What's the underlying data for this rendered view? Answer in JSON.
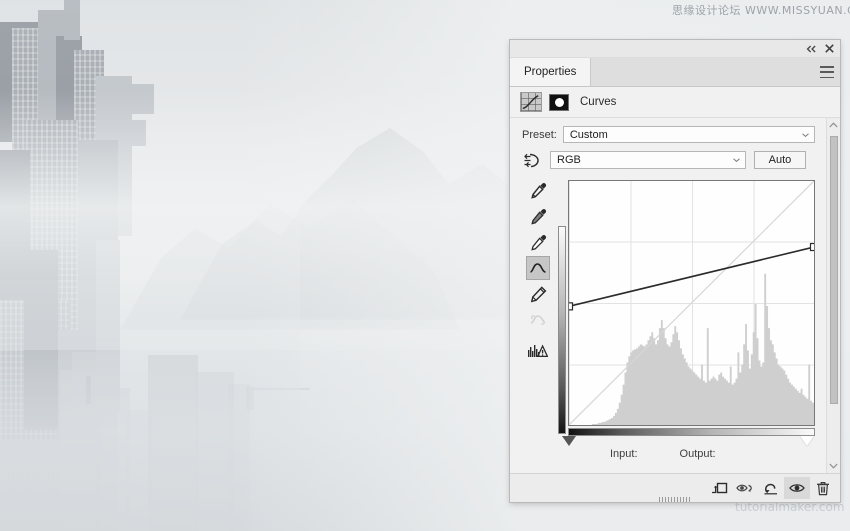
{
  "watermarks": {
    "top": "思缘设计论坛 WWW.MISSYUAN.COM",
    "bottom": "tutorialmaker.com"
  },
  "panel": {
    "titlebar": {
      "collapse_icon": "double-chevron-left-icon",
      "close_icon": "close-icon"
    },
    "tab": "Properties",
    "menu_icon": "panel-menu-icon",
    "adjustment": {
      "icon": "curves-adjustment-icon",
      "mask_icon": "layer-mask-thumbnail",
      "title": "Curves"
    },
    "preset": {
      "label": "Preset:",
      "value": "Custom",
      "chevron_icon": "chevron-down-icon"
    },
    "channel": {
      "target_adjust_icon": "on-image-adjustment-icon",
      "value": "RGB",
      "chevron_icon": "chevron-down-icon",
      "auto_label": "Auto"
    },
    "tools": [
      {
        "name": "sample-in-image-to-set-black-point",
        "icon": "eyedropper-black-icon",
        "selected": false,
        "disabled": false
      },
      {
        "name": "sample-in-image-to-set-gray-point",
        "icon": "eyedropper-gray-icon",
        "selected": false,
        "disabled": false
      },
      {
        "name": "sample-in-image-to-set-white-point",
        "icon": "eyedropper-white-icon",
        "selected": false,
        "disabled": false
      },
      {
        "name": "edit-points-to-modify-curve",
        "icon": "curve-point-tool-icon",
        "selected": true,
        "disabled": false
      },
      {
        "name": "draw-to-modify-curve",
        "icon": "pencil-icon",
        "selected": false,
        "disabled": false
      },
      {
        "name": "smooth-curve-values",
        "icon": "smooth-curve-icon",
        "selected": false,
        "disabled": true
      },
      {
        "name": "curves-display-options",
        "icon": "histogram-warning-icon",
        "selected": false,
        "disabled": false
      }
    ],
    "io": {
      "input_label": "Input:",
      "output_label": "Output:",
      "input_value": "",
      "output_value": ""
    },
    "sliders": {
      "black_point_handle": "black-point-slider",
      "white_point_handle": "white-point-slider"
    },
    "scrollbar": {
      "up_icon": "chevron-up-icon",
      "down_icon": "chevron-down-icon"
    },
    "footer_buttons": [
      {
        "name": "clip-to-layer-button",
        "icon": "clip-to-layer-icon",
        "active": false
      },
      {
        "name": "toggle-layer-visibility-previous-state-button",
        "icon": "eye-previous-state-icon",
        "active": false
      },
      {
        "name": "reset-to-adjustment-defaults-button",
        "icon": "reset-arrow-icon",
        "active": false
      },
      {
        "name": "toggle-layer-visibility-button",
        "icon": "eye-icon",
        "active": true
      },
      {
        "name": "delete-adjustment-layer-button",
        "icon": "trash-icon",
        "active": false
      }
    ]
  },
  "chart_data": {
    "type": "line",
    "title": "Curves (RGB)",
    "xlabel": "Input",
    "ylabel": "Output",
    "xlim": [
      0,
      255
    ],
    "ylim": [
      0,
      255
    ],
    "grid": true,
    "grid_divisions": 4,
    "identity_baseline": true,
    "series": [
      {
        "name": "RGB curve",
        "points": [
          [
            0,
            124
          ],
          [
            255,
            186
          ]
        ],
        "control_points": [
          {
            "input": 0,
            "output": 124
          },
          {
            "input": 255,
            "output": 186
          }
        ]
      }
    ],
    "histogram": {
      "name": "Composite histogram",
      "bins": 128,
      "values": [
        0,
        0,
        0,
        0,
        0,
        0,
        0,
        0,
        0,
        0,
        0,
        0,
        1,
        1,
        1,
        2,
        2,
        3,
        3,
        4,
        5,
        6,
        7,
        9,
        12,
        16,
        22,
        30,
        40,
        52,
        62,
        68,
        72,
        74,
        75,
        76,
        78,
        80,
        79,
        78,
        80,
        84,
        88,
        92,
        86,
        80,
        84,
        96,
        104,
        96,
        86,
        80,
        78,
        82,
        90,
        98,
        92,
        84,
        76,
        70,
        66,
        62,
        58,
        56,
        54,
        52,
        50,
        48,
        46,
        60,
        44,
        42,
        96,
        44,
        46,
        48,
        46,
        44,
        50,
        52,
        48,
        46,
        44,
        42,
        58,
        40,
        42,
        46,
        72,
        52,
        60,
        80,
        100,
        74,
        56,
        70,
        92,
        120,
        86,
        64,
        58,
        62,
        150,
        118,
        96,
        84,
        80,
        72,
        66,
        60,
        58,
        56,
        54,
        50,
        46,
        42,
        40,
        38,
        36,
        34,
        32,
        36,
        30,
        28,
        26,
        60,
        24,
        22
      ]
    }
  }
}
